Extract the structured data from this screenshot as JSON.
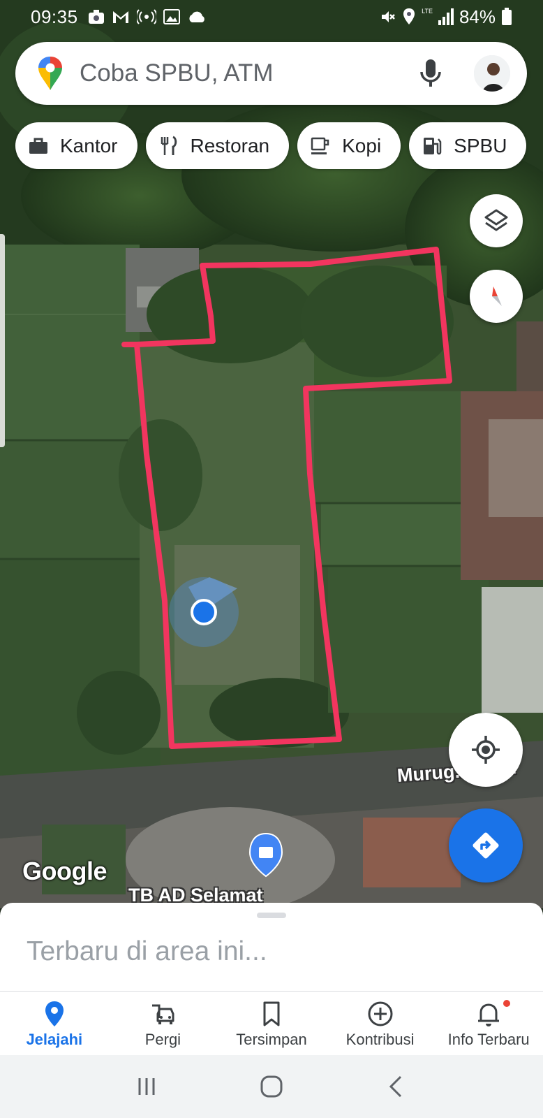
{
  "status_bar": {
    "time": "09:35",
    "battery": "84%",
    "network": "LTE"
  },
  "search": {
    "placeholder": "Coba SPBU, ATM",
    "icons": [
      "google-maps-pin-icon",
      "mic-icon",
      "avatar"
    ]
  },
  "chips": [
    {
      "label": "Kantor",
      "icon": "briefcase-icon"
    },
    {
      "label": "Restoran",
      "icon": "fork-knife-icon"
    },
    {
      "label": "Kopi",
      "icon": "coffee-cup-icon"
    },
    {
      "label": "SPBU",
      "icon": "gas-pump-icon"
    }
  ],
  "map": {
    "road_label": "Murug...Baka",
    "place_label": "TB AD Selamat",
    "logo": "Google",
    "colors": {
      "boundary": "#f2355f",
      "location_dot": "#1a73e8",
      "vegetation": "#3f5a34"
    }
  },
  "bottom_sheet": {
    "title": "Terbaru di area ini..."
  },
  "bottom_nav": [
    {
      "label": "Jelajahi",
      "icon": "location-pin-icon",
      "active": true
    },
    {
      "label": "Pergi",
      "icon": "car-icon",
      "active": false
    },
    {
      "label": "Tersimpan",
      "icon": "bookmark-icon",
      "active": false
    },
    {
      "label": "Kontribusi",
      "icon": "plus-circle-icon",
      "active": false
    },
    {
      "label": "Info Terbaru",
      "icon": "bell-icon",
      "active": false,
      "badge": true
    }
  ],
  "system_nav": [
    "recents-icon",
    "home-icon",
    "back-icon"
  ],
  "accent_color": "#1a73e8"
}
